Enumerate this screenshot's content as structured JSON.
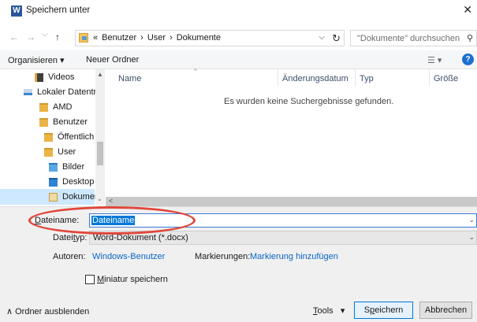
{
  "window": {
    "app_icon": "W",
    "title": "Speichern unter",
    "close_label": "✕"
  },
  "nav": {
    "back_icon": "←",
    "forward_icon": "→",
    "dropdown_icon": "⌵",
    "up_icon": "↑"
  },
  "address": {
    "crumbs": [
      "«",
      "Benutzer",
      "›",
      "User",
      "›",
      "Dokumente"
    ],
    "dropdown": "⌵",
    "refresh": "↻"
  },
  "search": {
    "placeholder": "\"Dokumente\" durchsuchen",
    "icon": "⚲"
  },
  "toolbar": {
    "organize": "Organisieren ▾",
    "new_folder": "Neuer Ordner",
    "view_icon": "☰ ▾",
    "help": "?"
  },
  "tree": {
    "items": [
      {
        "label": "Videos",
        "icon": "video"
      },
      {
        "label": "Lokaler Datentr",
        "icon": "drive"
      },
      {
        "label": "AMD",
        "icon": "folder"
      },
      {
        "label": "Benutzer",
        "icon": "folder"
      },
      {
        "label": "Öffentlich",
        "icon": "folder"
      },
      {
        "label": "User",
        "icon": "folder"
      },
      {
        "label": "Bilder",
        "icon": "pictures"
      },
      {
        "label": "Desktop",
        "icon": "desktop"
      },
      {
        "label": "Dokument",
        "icon": "documents"
      }
    ]
  },
  "columns": {
    "name": "Name",
    "date": "Änderungsdatum",
    "type": "Typ",
    "size": "Größe"
  },
  "empty_message": "Es wurden keine Suchergebnisse gefunden.",
  "form": {
    "filename_label_u": "D",
    "filename_label_rest": "ateiname:",
    "filename_value": "Dateiname",
    "filetype_label_a": "Datei",
    "filetype_label_u": "t",
    "filetype_label_rest": "yp:",
    "filetype_value": "Word-Dokument (*.docx)",
    "authors_label": "Autoren:",
    "authors_value": "Windows-Benutzer",
    "tags_label": "Markierungen:",
    "tags_value": "Markierung hinzufügen",
    "thumbnail_u": "M",
    "thumbnail_rest": "iniatur speichern"
  },
  "footer": {
    "hide_folders": "∧ Ordner ausblenden",
    "tools_u": "T",
    "tools_rest": "ools",
    "tools_caret": "▾",
    "save_a": "S",
    "save_u": "p",
    "save_rest": "eichern",
    "cancel": "Abbrechen"
  },
  "colors": {
    "accent": "#0078d7",
    "highlight_ring": "#e0463b",
    "selection": "#cde8ff"
  }
}
